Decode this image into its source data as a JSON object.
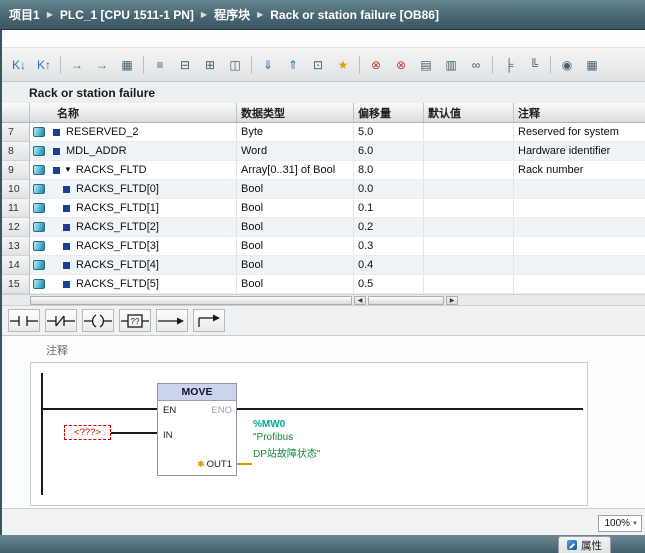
{
  "breadcrumb": {
    "separator": "▶",
    "items": [
      "项目1",
      "PLC_1 [CPU 1511-1 PN]",
      "程序块",
      "Rack or station failure [OB86]"
    ]
  },
  "toolbar": {
    "icons": [
      {
        "name": "keep-actual-values-icon",
        "glyph": "K↓"
      },
      {
        "name": "snapshot-actual-values-icon",
        "glyph": "K↑"
      },
      {
        "name": "copy-snapshots-to-start-values-icon",
        "glyph": "→"
      },
      {
        "name": "load-start-values-icon",
        "glyph": "→"
      },
      {
        "name": "import-export-icon",
        "glyph": "▦"
      },
      {
        "name": "expand-all-icon",
        "glyph": "≡"
      },
      {
        "name": "collapse-all-icon",
        "glyph": "⊟"
      },
      {
        "name": "insert-row-icon",
        "glyph": "⊞"
      },
      {
        "name": "comment-icon",
        "glyph": "◫"
      },
      {
        "name": "download-to-device-icon",
        "glyph": "⇓"
      },
      {
        "name": "upload-from-device-icon",
        "glyph": "⇑"
      },
      {
        "name": "absolute-relative-operands-icon",
        "glyph": "⊡"
      },
      {
        "name": "favorites-icon",
        "glyph": "★"
      },
      {
        "name": "go-offline-icon",
        "glyph": "⊗"
      },
      {
        "name": "cancel-action-icon",
        "glyph": "⊗"
      },
      {
        "name": "start-module-icon",
        "glyph": "▤"
      },
      {
        "name": "stop-module-icon",
        "glyph": "▥"
      },
      {
        "name": "monitor-icon",
        "glyph": "∞"
      },
      {
        "name": "compare-icon",
        "glyph": "╞"
      },
      {
        "name": "call-structure-icon",
        "glyph": "╚"
      },
      {
        "name": "cross-reference-icon",
        "glyph": "◉"
      },
      {
        "name": "overview-icon",
        "glyph": "▦"
      }
    ]
  },
  "section_title": "Rack or station failure",
  "table": {
    "headers": {
      "name": "名称",
      "datatype": "数据类型",
      "offset": "偏移量",
      "default": "默认值",
      "comment": "注释"
    },
    "rows": [
      {
        "num": "7",
        "name": "RESERVED_2",
        "datatype": "Byte",
        "offset": "5.0",
        "default": "",
        "comment": "Reserved for system",
        "caret": ""
      },
      {
        "num": "8",
        "name": "MDL_ADDR",
        "datatype": "Word",
        "offset": "6.0",
        "default": "",
        "comment": "Hardware identifier",
        "caret": ""
      },
      {
        "num": "9",
        "name": "RACKS_FLTD",
        "datatype": "Array[0..31] of Bool",
        "offset": "8.0",
        "default": "",
        "comment": "Rack number",
        "caret": "▼"
      },
      {
        "num": "10",
        "name": "RACKS_FLTD[0]",
        "datatype": "Bool",
        "offset": "0.0",
        "default": "",
        "comment": ""
      },
      {
        "num": "11",
        "name": "RACKS_FLTD[1]",
        "datatype": "Bool",
        "offset": "0.1",
        "default": "",
        "comment": ""
      },
      {
        "num": "12",
        "name": "RACKS_FLTD[2]",
        "datatype": "Bool",
        "offset": "0.2",
        "default": "",
        "comment": ""
      },
      {
        "num": "13",
        "name": "RACKS_FLTD[3]",
        "datatype": "Bool",
        "offset": "0.3",
        "default": "",
        "comment": ""
      },
      {
        "num": "14",
        "name": "RACKS_FLTD[4]",
        "datatype": "Bool",
        "offset": "0.4",
        "default": "",
        "comment": ""
      },
      {
        "num": "15",
        "name": "RACKS_FLTD[5]",
        "datatype": "Bool",
        "offset": "0.5",
        "default": "",
        "comment": ""
      }
    ]
  },
  "hscroll": {
    "left_arrow": "◀",
    "right_arrow": "▶"
  },
  "lad_toolbar": {
    "empty_box_label": "??"
  },
  "comment_label": "注释",
  "network": {
    "box_title": "MOVE",
    "en": "EN",
    "eno": "ENO",
    "in_label": "IN",
    "out_label": "OUT1",
    "out_icon": "✱",
    "placeholder": "<???>",
    "operand": {
      "address": "%MW0",
      "name_line1": "\"Profibus",
      "name_line2": "DP站故障状态\""
    }
  },
  "zoom": {
    "value": "100%"
  },
  "inspector": {
    "properties_label": "属性"
  },
  "colors": {
    "accent_teal": "#00a695",
    "operand_green": "#0e8c36",
    "error_red": "#cc0000",
    "wire_orange": "#e09600",
    "box_header": "#ccd4ec"
  }
}
